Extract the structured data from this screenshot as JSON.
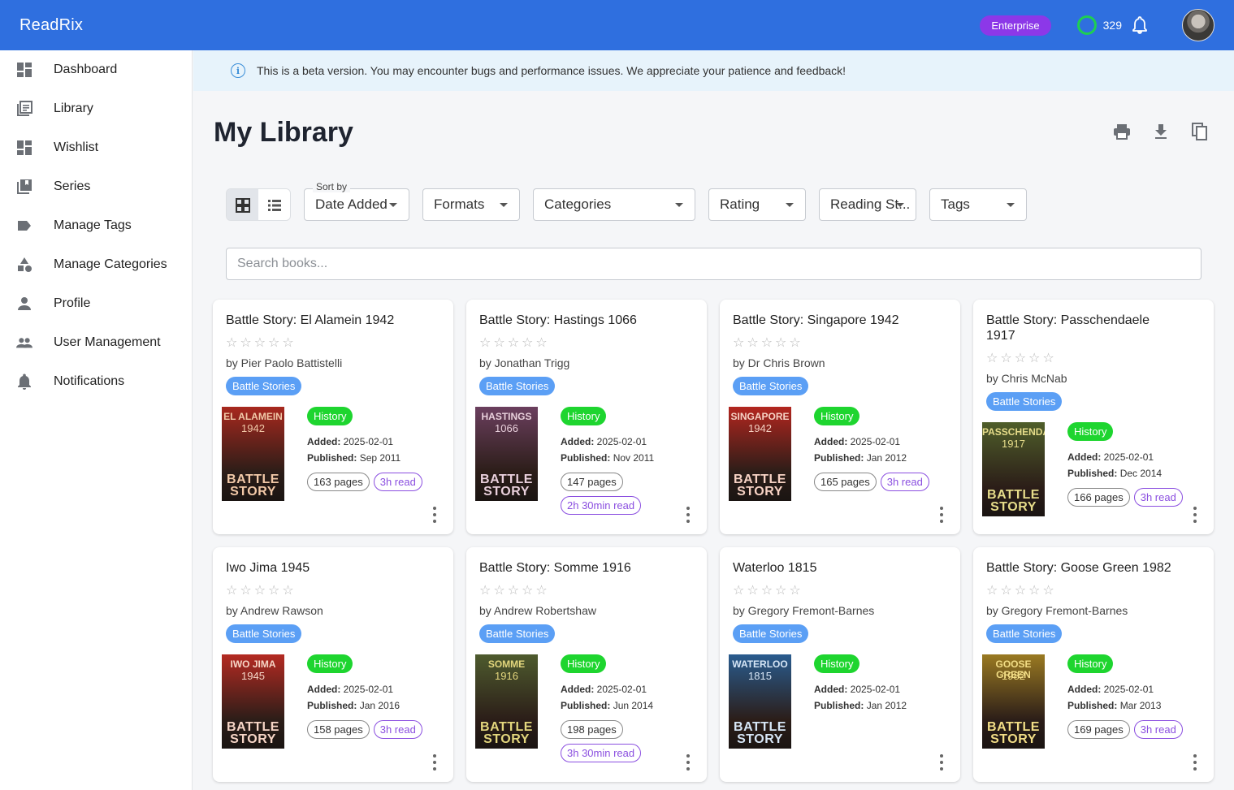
{
  "app": {
    "brand": "ReadRix",
    "plan_badge": "Enterprise",
    "points": "329"
  },
  "sidebar": {
    "items": [
      {
        "label": "Dashboard",
        "icon": "dashboard-icon"
      },
      {
        "label": "Library",
        "icon": "library-icon"
      },
      {
        "label": "Wishlist",
        "icon": "wishlist-icon"
      },
      {
        "label": "Series",
        "icon": "series-icon"
      },
      {
        "label": "Manage Tags",
        "icon": "tag-icon"
      },
      {
        "label": "Manage Categories",
        "icon": "categories-icon"
      },
      {
        "label": "Profile",
        "icon": "person-icon"
      },
      {
        "label": "User Management",
        "icon": "people-icon"
      },
      {
        "label": "Notifications",
        "icon": "bell-icon"
      }
    ]
  },
  "banner": {
    "text": "This is a beta version. You may encounter bugs and performance issues. We appreciate your patience and feedback!"
  },
  "page": {
    "title": "My Library"
  },
  "filters": {
    "sort_label": "Sort by",
    "sort_value": "Date Added",
    "formats": "Formats",
    "categories": "Categories",
    "rating": "Rating",
    "reading_status": "Reading St...",
    "tags": "Tags"
  },
  "search": {
    "placeholder": "Search books..."
  },
  "labels": {
    "added": "Added:",
    "published": "Published:"
  },
  "colors": {
    "topbar": "#2f6fdf",
    "badge": "#8c38e8",
    "category_chip": "#5b9ff5",
    "genre_chip": "#1ed52f",
    "read_pill": "#8b4fe0"
  },
  "books": [
    {
      "title": "Battle Story: El Alamein 1942",
      "author": "by Pier Paolo Battistelli",
      "category": "Battle Stories",
      "genre": "History",
      "added": "2025-02-01",
      "published": "Sep 2011",
      "pages": "163 pages",
      "read": "3h read",
      "cover": {
        "top": "EL ALAMEIN",
        "year": "1942",
        "series": "BATTLE STORY",
        "bg": "#a8281e",
        "fg": "#f2c9a8"
      }
    },
    {
      "title": "Battle Story: Hastings 1066",
      "author": "by Jonathan Trigg",
      "category": "Battle Stories",
      "genre": "History",
      "added": "2025-02-01",
      "published": "Nov 2011",
      "pages": "147 pages",
      "read": "2h 30min read",
      "cover": {
        "top": "HASTINGS",
        "year": "1066",
        "series": "BATTLE STORY",
        "bg": "#6b3f5e",
        "fg": "#e9d0dc"
      }
    },
    {
      "title": "Battle Story: Singapore 1942",
      "author": "by Dr Chris Brown",
      "category": "Battle Stories",
      "genre": "History",
      "added": "2025-02-01",
      "published": "Jan 2012",
      "pages": "165 pages",
      "read": "3h read",
      "cover": {
        "top": "SINGAPORE",
        "year": "1942",
        "series": "BATTLE STORY",
        "bg": "#b3261f",
        "fg": "#f7d2c4"
      }
    },
    {
      "title": "Battle Story: Passchendaele 1917",
      "author": "by Chris McNab",
      "category": "Battle Stories",
      "genre": "History",
      "added": "2025-02-01",
      "published": "Dec 2014",
      "pages": "166 pages",
      "read": "3h read",
      "cover": {
        "top": "PASSCHENDAELE",
        "year": "1917",
        "series": "BATTLE STORY",
        "bg": "#4f5e2a",
        "fg": "#e6dc8a"
      }
    },
    {
      "title": "Iwo Jima 1945",
      "author": "by Andrew Rawson",
      "category": "Battle Stories",
      "genre": "History",
      "added": "2025-02-01",
      "published": "Jan 2016",
      "pages": "158 pages",
      "read": "3h read",
      "cover": {
        "top": "IWO JIMA",
        "year": "1945",
        "series": "BATTLE STORY",
        "bg": "#b52a22",
        "fg": "#f6d5c6"
      }
    },
    {
      "title": "Battle Story: Somme 1916",
      "author": "by Andrew Robertshaw",
      "category": "Battle Stories",
      "genre": "History",
      "added": "2025-02-01",
      "published": "Jun 2014",
      "pages": "198 pages",
      "read": "3h 30min read",
      "cover": {
        "top": "SOMME",
        "year": "1916",
        "series": "BATTLE STORY",
        "bg": "#4e5b2e",
        "fg": "#e3d67d"
      }
    },
    {
      "title": "Waterloo 1815",
      "author": "by Gregory Fremont-Barnes",
      "category": "Battle Stories",
      "genre": "History",
      "added": "2025-02-01",
      "published": "Jan 2012",
      "pages": "",
      "read": "",
      "cover": {
        "top": "WATERLOO",
        "year": "1815",
        "series": "BATTLE STORY",
        "bg": "#2a5c8f",
        "fg": "#d7e6f6"
      }
    },
    {
      "title": "Battle Story: Goose Green 1982",
      "author": "by Gregory Fremont-Barnes",
      "category": "Battle Stories",
      "genre": "History",
      "added": "2025-02-01",
      "published": "Mar 2013",
      "pages": "169 pages",
      "read": "3h read",
      "cover": {
        "top": "GOOSE GREEN",
        "year": "1982",
        "series": "BATTLE STORY",
        "bg": "#9a7a22",
        "fg": "#f2dd86"
      }
    }
  ]
}
